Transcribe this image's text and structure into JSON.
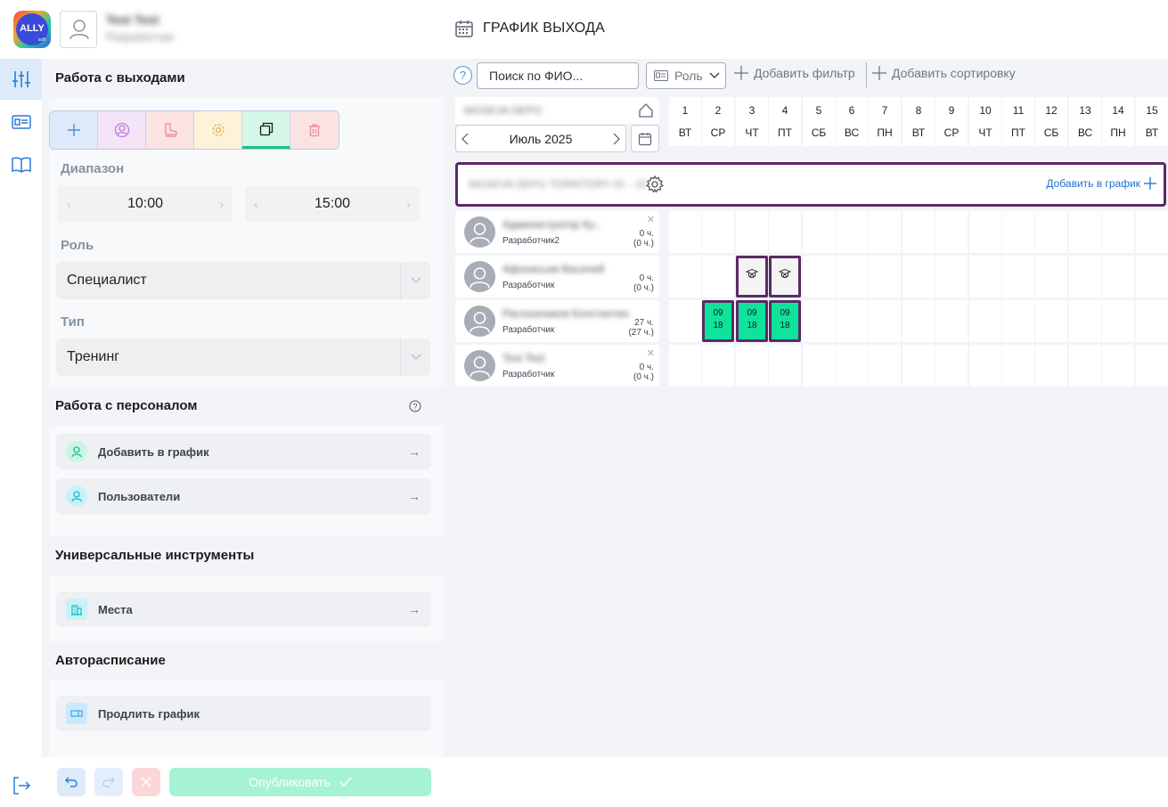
{
  "header": {
    "user_name": "Test Test",
    "user_role": "Разработчик",
    "logo_text": "ALLY",
    "logo_sub": "soft",
    "page_title": "ГРАФИК ВЫХОДА"
  },
  "rail": {
    "items": [
      "sliders-icon",
      "id-card-icon",
      "book-icon"
    ],
    "logout": "logout-icon"
  },
  "panel": {
    "exits_section": {
      "title": "Работа с выходами",
      "tools": [
        {
          "name": "add",
          "bg": "#dceaf9",
          "color": "#4d8fd9"
        },
        {
          "name": "users",
          "bg": "#f3e4f7",
          "color": "#c07be0"
        },
        {
          "name": "boot",
          "bg": "#fbe3e4",
          "color": "#ec8a91"
        },
        {
          "name": "gear",
          "bg": "#fdf2da",
          "color": "#e7b24d"
        },
        {
          "name": "copy",
          "bg": "#d4f7e8",
          "color": "#1a1a1a"
        },
        {
          "name": "trash",
          "bg": "#fbe3e4",
          "color": "#ec8a91"
        }
      ],
      "range_label": "Диапазон",
      "time_from": "10:00",
      "time_to": "15:00",
      "role_label": "Роль",
      "role_value": "Специалист",
      "type_label": "Тип",
      "type_value": "Тренинг"
    },
    "staff_section": {
      "title": "Работа с персоналом",
      "actions": [
        {
          "label": "Добавить в график",
          "icon": "user-icon",
          "color": "#1fbf84",
          "bg": "#c9f5e4"
        },
        {
          "label": "Пользователи",
          "icon": "user-icon",
          "color": "#14b8c8",
          "bg": "#c9f2f6"
        }
      ]
    },
    "tools_section": {
      "title": "Универсальные инструменты",
      "actions": [
        {
          "label": "Места",
          "icon": "building-icon",
          "color": "#14b8c8",
          "bg": "#c9f2f6"
        }
      ]
    },
    "auto_section": {
      "title": "Авторасписание",
      "actions": [
        {
          "label": "Продлить график",
          "icon": "extend-icon",
          "color": "#3aa5e8",
          "bg": "#cce9fb"
        }
      ]
    }
  },
  "bottom": {
    "publish_label": "Опубликовать"
  },
  "main": {
    "search_placeholder": "Поиск по ФИО...",
    "role_filter": "Роль",
    "add_filter": "Добавить фильтр",
    "add_sort": "Добавить сортировку",
    "org_name": "MOSKVA DEPO",
    "month": "Июль 2025",
    "days": [
      {
        "num": "1",
        "dow": "ВТ"
      },
      {
        "num": "2",
        "dow": "СР"
      },
      {
        "num": "3",
        "dow": "ЧТ"
      },
      {
        "num": "4",
        "dow": "ПТ"
      },
      {
        "num": "5",
        "dow": "СБ"
      },
      {
        "num": "6",
        "dow": "ВС"
      },
      {
        "num": "7",
        "dow": "ПН"
      },
      {
        "num": "8",
        "dow": "ВТ"
      },
      {
        "num": "9",
        "dow": "СР"
      },
      {
        "num": "10",
        "dow": "ЧТ"
      },
      {
        "num": "11",
        "dow": "ПТ"
      },
      {
        "num": "12",
        "dow": "СБ"
      },
      {
        "num": "13",
        "dow": "ВС"
      },
      {
        "num": "14",
        "dow": "ПН"
      },
      {
        "num": "15",
        "dow": "ВТ"
      }
    ],
    "group_name": "MOSKVA DEPO TERRITORY 01 - 10",
    "add_to_schedule": "Добавить в график",
    "employees": [
      {
        "name": "Администратор Ку...",
        "role": "Разработчик2",
        "hours": "0 ч.",
        "hours_sub": "(0 ч.)",
        "removable": true,
        "shifts": []
      },
      {
        "name": "Афонасьев Василий",
        "role": "Разработчик",
        "hours": "0 ч.",
        "hours_sub": "(0 ч.)",
        "removable": false,
        "shifts": [
          {
            "day": 3,
            "kind": "training"
          },
          {
            "day": 4,
            "kind": "training"
          }
        ]
      },
      {
        "name": "Рассказчиков Константин",
        "role": "Разработчик",
        "hours": "27 ч.",
        "hours_sub": "(27 ч.)",
        "removable": false,
        "shifts": [
          {
            "day": 2,
            "kind": "work",
            "start": "09",
            "end": "18"
          },
          {
            "day": 3,
            "kind": "work",
            "start": "09",
            "end": "18"
          },
          {
            "day": 4,
            "kind": "work",
            "start": "09",
            "end": "18"
          }
        ]
      },
      {
        "name": "Test Test",
        "role": "Разработчик",
        "hours": "0 ч.",
        "hours_sub": "(0 ч.)",
        "removable": true,
        "shifts": []
      }
    ]
  },
  "colors": {
    "accent": "#4d8fd9",
    "shift_green": "#0ee39c",
    "border_purple": "#5b2a66",
    "publish": "#a6f3d3"
  }
}
